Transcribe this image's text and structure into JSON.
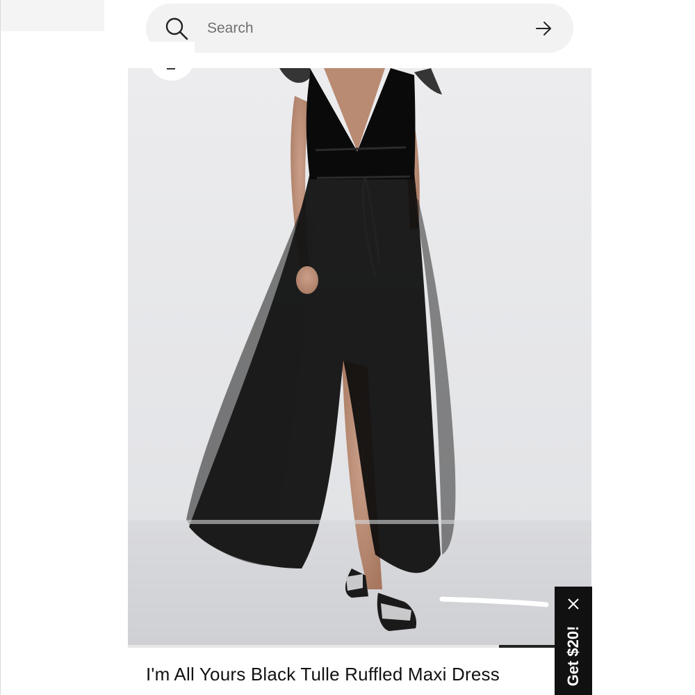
{
  "search": {
    "placeholder": "Search"
  },
  "product": {
    "title": "I'm All Yours Black Tulle Ruffled Maxi Dress",
    "image_alt": "Model wearing black tulle ruffled maxi dress with front slit"
  },
  "promo": {
    "label": "Get $20!"
  },
  "icons": {
    "search": "search-icon",
    "submit": "arrow-right-icon",
    "zoom": "zoom-out-icon",
    "close": "close-icon"
  },
  "colors": {
    "search_bg": "#f2f2f2",
    "promo_bg": "#111111",
    "dress": "#0b0b0b",
    "backdrop": "#e9eaec"
  }
}
